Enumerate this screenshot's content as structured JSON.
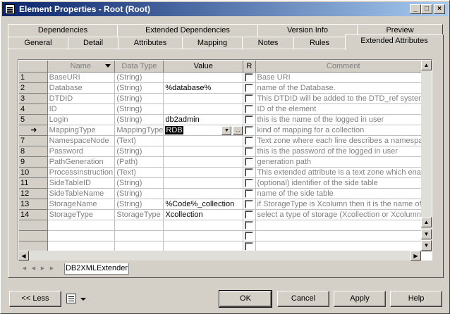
{
  "window": {
    "title": "Element Properties - Root (Root)",
    "controls": {
      "minimize": "_",
      "maximize": "□",
      "close": "×"
    }
  },
  "tabs_back": [
    {
      "label": "Dependencies"
    },
    {
      "label": "Extended Dependencies"
    },
    {
      "label": "Version Info"
    },
    {
      "label": "Preview"
    }
  ],
  "tabs_front": [
    {
      "label": "General"
    },
    {
      "label": "Detail"
    },
    {
      "label": "Attributes"
    },
    {
      "label": "Mapping"
    },
    {
      "label": "Notes"
    },
    {
      "label": "Rules"
    },
    {
      "label": "Extended Attributes",
      "active": true
    }
  ],
  "grid": {
    "columns": {
      "name": "Name",
      "datatype": "Data Type",
      "value": "Value",
      "r": "R",
      "comment": "Comment"
    },
    "rows": [
      {
        "num": "1",
        "name": "BaseURI",
        "type": "(String)",
        "value": "",
        "comment": "Base URI"
      },
      {
        "num": "2",
        "name": "Database",
        "type": "(String)",
        "value": "%database%",
        "comment": "name of the Database."
      },
      {
        "num": "3",
        "name": "DTDID",
        "type": "(String)",
        "value": "",
        "comment": "This DTDID will be added to the DTD_ref system"
      },
      {
        "num": "4",
        "name": "ID",
        "type": "(String)",
        "value": "",
        "comment": "ID of the element"
      },
      {
        "num": "5",
        "name": "Login",
        "type": "(String)",
        "value": "db2admin",
        "comment": "this is the name of the logged in user"
      },
      {
        "num": "➜",
        "name": "MappingType",
        "type": "MappingType",
        "value": "RDB",
        "comment": "kind of mapping for a collection",
        "current": true
      },
      {
        "num": "7",
        "name": "NamespaceNode",
        "type": "(Text)",
        "value": "",
        "comment": "Text zone where each line describes a namespace"
      },
      {
        "num": "8",
        "name": "Password",
        "type": "(String)",
        "value": "",
        "comment": "this is the password of the logged in user"
      },
      {
        "num": "9",
        "name": "PathGeneration",
        "type": "(Path)",
        "value": "",
        "comment": "generation path"
      },
      {
        "num": "10",
        "name": "ProcessInstruction",
        "type": "(Text)",
        "value": "",
        "comment": "This extended attribute is a text zone which enab"
      },
      {
        "num": "11",
        "name": "SideTableID",
        "type": "(String)",
        "value": "",
        "comment": "(optional) identifier of the side table"
      },
      {
        "num": "12",
        "name": "SideTableName",
        "type": "(String)",
        "value": "",
        "comment": "name of the side table"
      },
      {
        "num": "13",
        "name": "StorageName",
        "type": "(String)",
        "value": "%Code%_collection",
        "comment": "if StorageType is Xcolumn then it is the name of"
      },
      {
        "num": "14",
        "name": "StorageType",
        "type": "StorageType",
        "value": "Xcollection",
        "comment": "select a type of storage (Xcollection or Xcolumn)"
      },
      {
        "num": "",
        "name": "",
        "type": "",
        "value": "",
        "comment": ""
      },
      {
        "num": "",
        "name": "",
        "type": "",
        "value": "",
        "comment": ""
      },
      {
        "num": "",
        "name": "",
        "type": "",
        "value": "",
        "comment": ""
      }
    ],
    "ellipsis": "..."
  },
  "sheet_tab": "DB2XMLExtender",
  "buttons": {
    "less": "<< Less",
    "ok": "OK",
    "cancel": "Cancel",
    "apply": "Apply",
    "help": "Help"
  },
  "icons": [
    "window-icon",
    "sort-arrow-icon",
    "dropdown-arrow-icon",
    "scroll-up-icon",
    "scroll-down-icon",
    "scroll-left-icon",
    "scroll-right-icon",
    "properties-menu-icon",
    "row-pointer-icon"
  ]
}
